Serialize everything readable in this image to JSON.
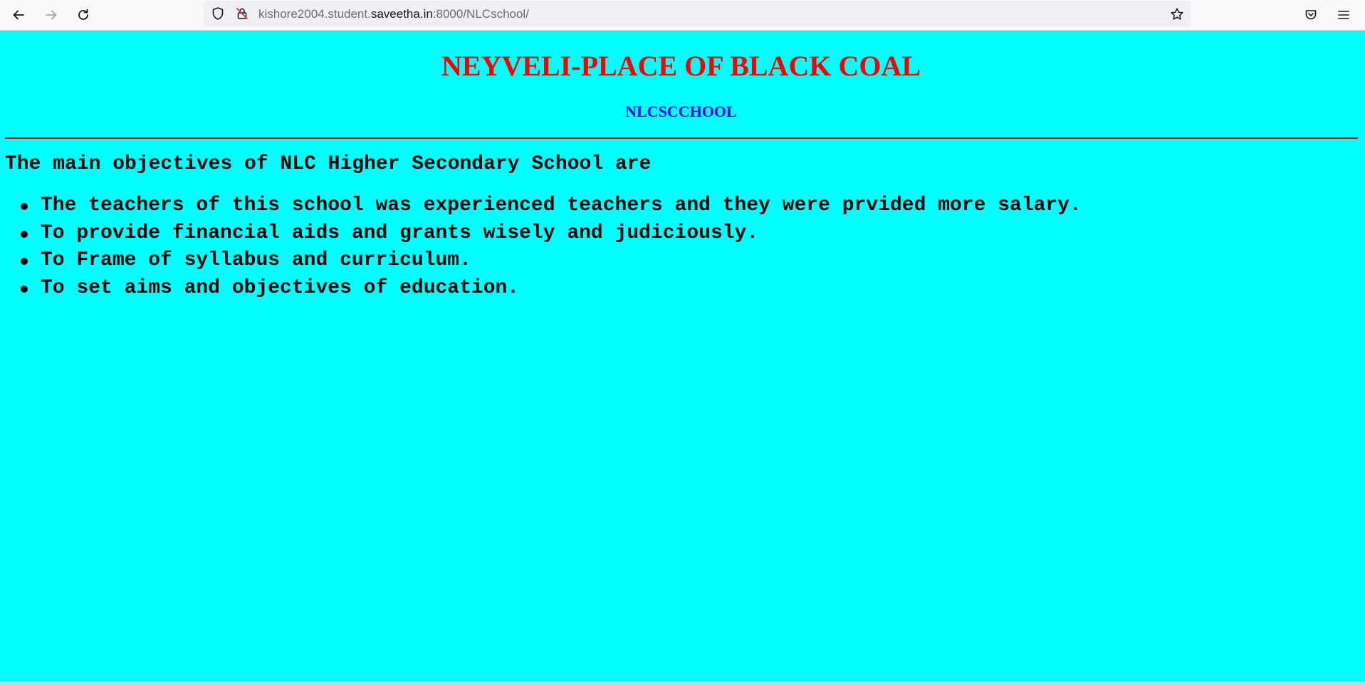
{
  "browser": {
    "url_prefix": "kishore2004.student.",
    "url_host": "saveetha.in",
    "url_suffix": ":8000/NLCschool/"
  },
  "page": {
    "title": "NEYVELI-PLACE OF BLACK COAL",
    "subtitle": "NLCSCCHOOL",
    "intro": "The main objectives of NLC Higher Secondary School are",
    "objectives": [
      "The teachers of this school was experienced teachers and they were prvided more salary.",
      "To provide financial aids and grants wisely and judiciously.",
      "To Frame of syllabus and curriculum.",
      "To set aims and objectives of education."
    ]
  },
  "colors": {
    "background": "#00ffff",
    "title": "#ff0000",
    "subtitle": "#0000ff",
    "rule": "#ff0000"
  }
}
